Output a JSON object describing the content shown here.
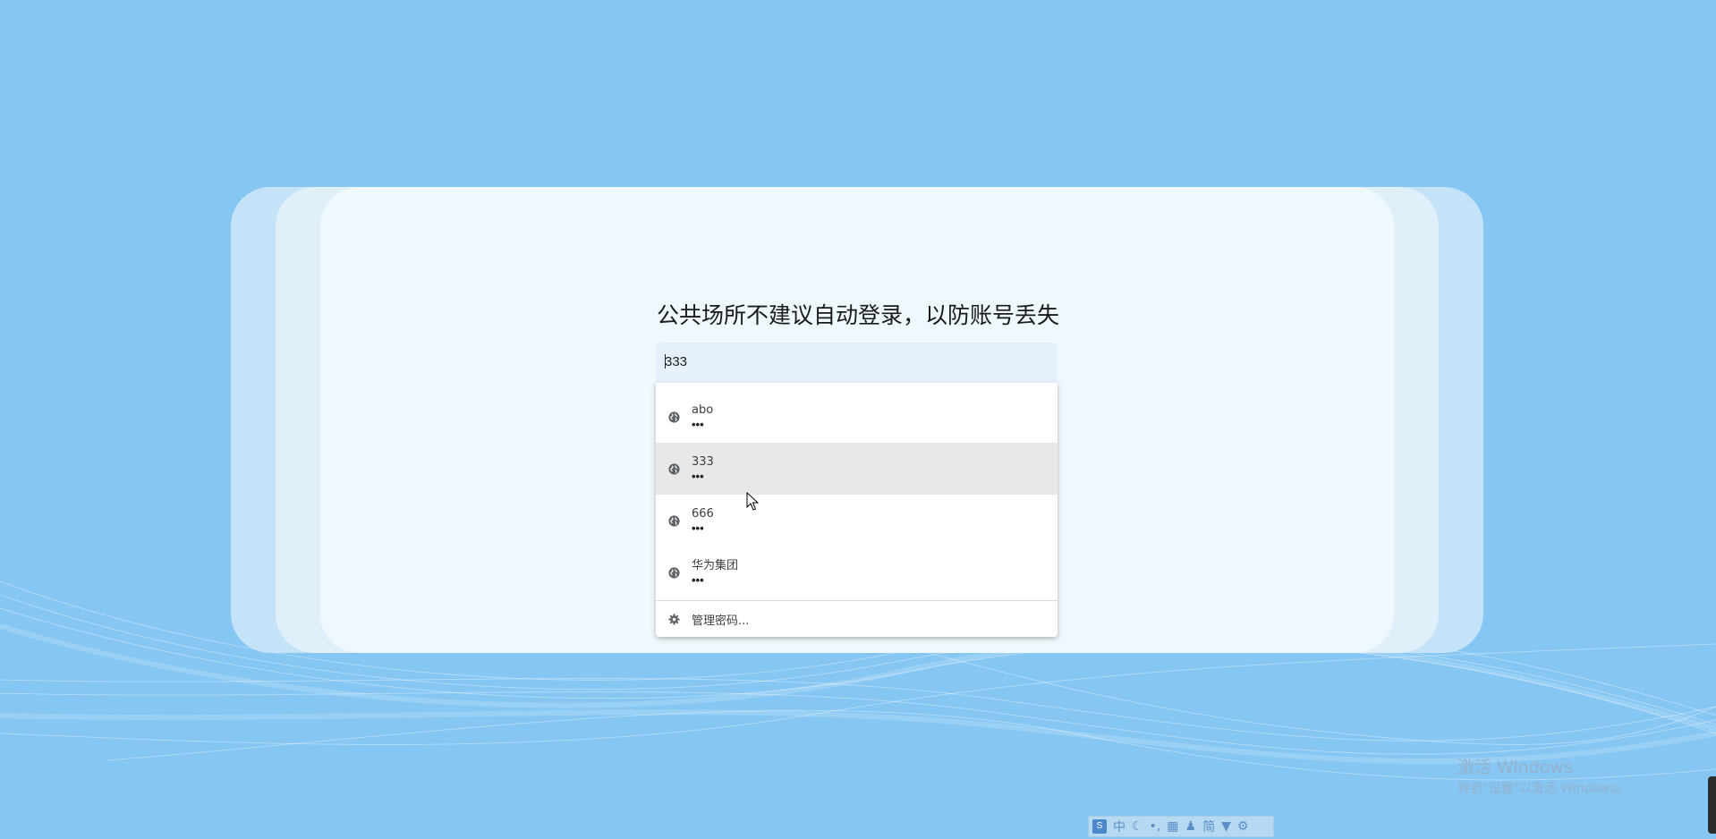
{
  "page": {
    "notice": "公共场所不建议自动登录，以防账号丢失"
  },
  "login": {
    "username_value": "333"
  },
  "autofill": {
    "items": [
      {
        "name": "abo",
        "password_mask": "•••",
        "icon": "globe-icon"
      },
      {
        "name": "333",
        "password_mask": "•••",
        "icon": "globe-icon",
        "hovered": true
      },
      {
        "name": "666",
        "password_mask": "•••",
        "icon": "globe-icon"
      },
      {
        "name": "华为集团",
        "password_mask": "•••",
        "icon": "globe-icon"
      }
    ],
    "manage_label": "管理密码...",
    "manage_icon": "gear-icon"
  },
  "system": {
    "watermark_line1": "激活 Windows",
    "watermark_line2": "转到\"设置\"以激活 Windows。",
    "ime_mode": "中",
    "ime_simplified": "简"
  },
  "colors": {
    "background": "#85c6f3",
    "card": "#eff8fc",
    "input_bg": "#e6f0fd",
    "hover_row": "#e8e8e8"
  }
}
